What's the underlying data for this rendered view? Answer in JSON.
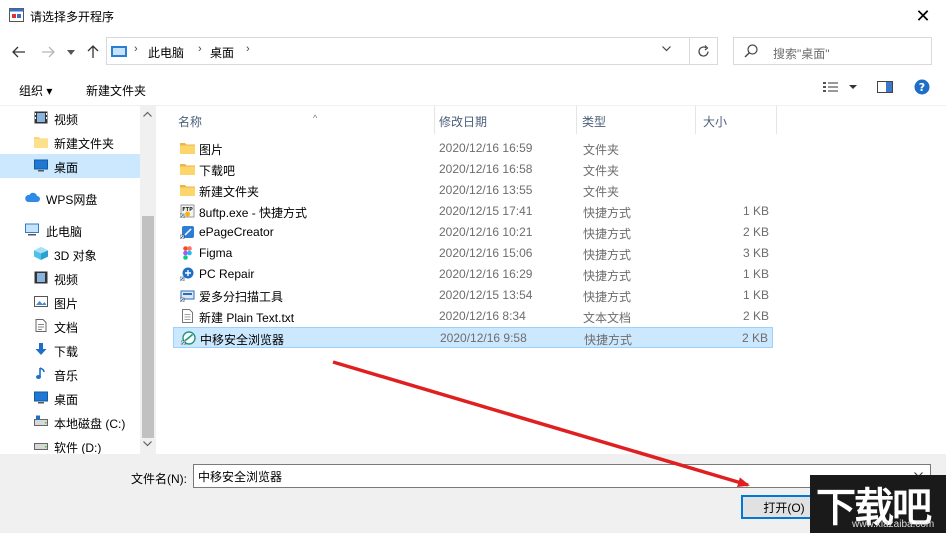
{
  "window": {
    "title": "请选择多开程序",
    "close_glyph": "✕"
  },
  "address": {
    "crumbs": [
      "此电脑",
      "桌面"
    ],
    "search_placeholder": "搜索\"桌面\""
  },
  "toolbar": {
    "organize": "组织 ▾",
    "new_folder": "新建文件夹"
  },
  "nav": {
    "items": [
      {
        "label": "视频",
        "icon": "video-icon"
      },
      {
        "label": "新建文件夹",
        "icon": "folder-icon"
      },
      {
        "label": "桌面",
        "icon": "desktop-icon"
      },
      {
        "label": "WPS网盘",
        "icon": "cloud-icon"
      },
      {
        "label": "此电脑",
        "icon": "computer-icon"
      },
      {
        "label": "3D 对象",
        "icon": "cube-icon"
      },
      {
        "label": "视频",
        "icon": "video-icon"
      },
      {
        "label": "图片",
        "icon": "picture-icon"
      },
      {
        "label": "文档",
        "icon": "document-icon"
      },
      {
        "label": "下载",
        "icon": "download-icon"
      },
      {
        "label": "音乐",
        "icon": "music-icon"
      },
      {
        "label": "桌面",
        "icon": "desktop-icon"
      },
      {
        "label": "本地磁盘 (C:)",
        "icon": "drive-icon"
      },
      {
        "label": "软件 (D:)",
        "icon": "drive-icon"
      }
    ]
  },
  "columns": {
    "name": "名称",
    "date": "修改日期",
    "type": "类型",
    "size": "大小"
  },
  "files": [
    {
      "name": "图片",
      "date": "2020/12/16 16:59",
      "type": "文件夹",
      "size": "",
      "icon": "folder-icon"
    },
    {
      "name": "下载吧",
      "date": "2020/12/16 16:58",
      "type": "文件夹",
      "size": "",
      "icon": "folder-icon"
    },
    {
      "name": "新建文件夹",
      "date": "2020/12/16 13:55",
      "type": "文件夹",
      "size": "",
      "icon": "folder-icon"
    },
    {
      "name": "8uftp.exe - 快捷方式",
      "date": "2020/12/15 17:41",
      "type": "快捷方式",
      "size": "1 KB",
      "icon": "ftp-shortcut-icon"
    },
    {
      "name": "ePageCreator",
      "date": "2020/12/16 10:21",
      "type": "快捷方式",
      "size": "2 KB",
      "icon": "app-shortcut-icon"
    },
    {
      "name": "Figma",
      "date": "2020/12/16 15:06",
      "type": "快捷方式",
      "size": "3 KB",
      "icon": "figma-icon"
    },
    {
      "name": "PC Repair",
      "date": "2020/12/16 16:29",
      "type": "快捷方式",
      "size": "1 KB",
      "icon": "app-shortcut-icon"
    },
    {
      "name": "爱多分扫描工具",
      "date": "2020/12/15 13:54",
      "type": "快捷方式",
      "size": "1 KB",
      "icon": "scanner-icon"
    },
    {
      "name": "新建 Plain Text.txt",
      "date": "2020/12/16 8:34",
      "type": "文本文档",
      "size": "2 KB",
      "icon": "text-file-icon"
    },
    {
      "name": "中移安全浏览器",
      "date": "2020/12/16 9:58",
      "type": "快捷方式",
      "size": "2 KB",
      "icon": "browser-icon"
    }
  ],
  "footer": {
    "filename_label": "文件名(N):",
    "filename_value": "中移安全浏览器",
    "open_button": "打开(O)"
  },
  "watermark": {
    "text": "下载吧",
    "url": "www.xiazaiba.com"
  },
  "colors": {
    "selection": "#cce8ff",
    "selection_border": "#99d1ff",
    "accent": "#0078d7",
    "annotation_arrow": "#e02020"
  }
}
